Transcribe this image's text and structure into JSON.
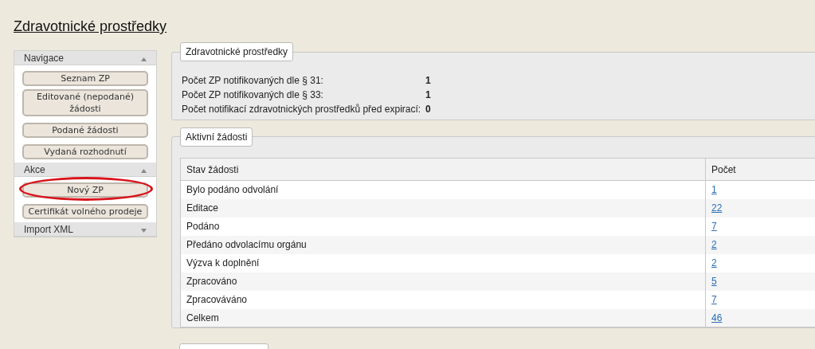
{
  "page_title": "Zdravotnické prostředky",
  "sidebar": {
    "sections": [
      {
        "title": "Navigace",
        "expanded": true,
        "items": [
          {
            "label": "Seznam ZP",
            "circled": false
          },
          {
            "label": "Editované (nepodané) žádosti",
            "circled": false
          },
          {
            "label": "Podané žádosti",
            "circled": false
          },
          {
            "label": "Vydaná rozhodnutí",
            "circled": false
          }
        ]
      },
      {
        "title": "Akce",
        "expanded": true,
        "items": [
          {
            "label": "Nový ZP",
            "circled": true
          },
          {
            "label": "Certifikát volného prodeje",
            "circled": false
          }
        ]
      },
      {
        "title": "Import XML",
        "expanded": false
      }
    ]
  },
  "summary_panel": {
    "legend": "Zdravotnické prostředky",
    "rows": [
      {
        "label": "Počet ZP notifikovaných dle § 31:",
        "value": "1"
      },
      {
        "label": "Počet ZP notifikovaných dle § 33:",
        "value": "1"
      },
      {
        "label": "Počet notifikací zdravotnických prostředků před expirací:",
        "value": "0"
      }
    ]
  },
  "requests_panel": {
    "legend": "Aktivní žádosti",
    "table": {
      "columns": [
        "Stav žádosti",
        "Počet"
      ],
      "rows": [
        [
          "Bylo podáno odvolání",
          "1"
        ],
        [
          "Editace",
          "22"
        ],
        [
          "Podáno",
          "7"
        ],
        [
          "Předáno odvolacímu orgánu",
          "2"
        ],
        [
          "Výzva k doplnění",
          "2"
        ],
        [
          "Zpracováno",
          "5"
        ],
        [
          "Zpracováváno",
          "7"
        ],
        [
          "Celkem",
          "46"
        ]
      ]
    }
  }
}
